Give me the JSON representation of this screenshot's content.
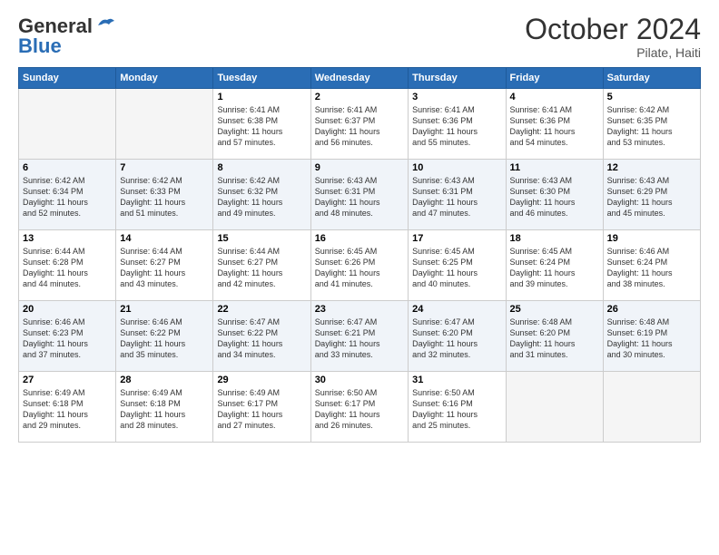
{
  "logo": {
    "part1": "General",
    "part2": "Blue"
  },
  "title": "October 2024",
  "location": "Pilate, Haiti",
  "headers": [
    "Sunday",
    "Monday",
    "Tuesday",
    "Wednesday",
    "Thursday",
    "Friday",
    "Saturday"
  ],
  "weeks": [
    [
      {
        "day": "",
        "info": ""
      },
      {
        "day": "",
        "info": ""
      },
      {
        "day": "1",
        "info": "Sunrise: 6:41 AM\nSunset: 6:38 PM\nDaylight: 11 hours\nand 57 minutes."
      },
      {
        "day": "2",
        "info": "Sunrise: 6:41 AM\nSunset: 6:37 PM\nDaylight: 11 hours\nand 56 minutes."
      },
      {
        "day": "3",
        "info": "Sunrise: 6:41 AM\nSunset: 6:36 PM\nDaylight: 11 hours\nand 55 minutes."
      },
      {
        "day": "4",
        "info": "Sunrise: 6:41 AM\nSunset: 6:36 PM\nDaylight: 11 hours\nand 54 minutes."
      },
      {
        "day": "5",
        "info": "Sunrise: 6:42 AM\nSunset: 6:35 PM\nDaylight: 11 hours\nand 53 minutes."
      }
    ],
    [
      {
        "day": "6",
        "info": "Sunrise: 6:42 AM\nSunset: 6:34 PM\nDaylight: 11 hours\nand 52 minutes."
      },
      {
        "day": "7",
        "info": "Sunrise: 6:42 AM\nSunset: 6:33 PM\nDaylight: 11 hours\nand 51 minutes."
      },
      {
        "day": "8",
        "info": "Sunrise: 6:42 AM\nSunset: 6:32 PM\nDaylight: 11 hours\nand 49 minutes."
      },
      {
        "day": "9",
        "info": "Sunrise: 6:43 AM\nSunset: 6:31 PM\nDaylight: 11 hours\nand 48 minutes."
      },
      {
        "day": "10",
        "info": "Sunrise: 6:43 AM\nSunset: 6:31 PM\nDaylight: 11 hours\nand 47 minutes."
      },
      {
        "day": "11",
        "info": "Sunrise: 6:43 AM\nSunset: 6:30 PM\nDaylight: 11 hours\nand 46 minutes."
      },
      {
        "day": "12",
        "info": "Sunrise: 6:43 AM\nSunset: 6:29 PM\nDaylight: 11 hours\nand 45 minutes."
      }
    ],
    [
      {
        "day": "13",
        "info": "Sunrise: 6:44 AM\nSunset: 6:28 PM\nDaylight: 11 hours\nand 44 minutes."
      },
      {
        "day": "14",
        "info": "Sunrise: 6:44 AM\nSunset: 6:27 PM\nDaylight: 11 hours\nand 43 minutes."
      },
      {
        "day": "15",
        "info": "Sunrise: 6:44 AM\nSunset: 6:27 PM\nDaylight: 11 hours\nand 42 minutes."
      },
      {
        "day": "16",
        "info": "Sunrise: 6:45 AM\nSunset: 6:26 PM\nDaylight: 11 hours\nand 41 minutes."
      },
      {
        "day": "17",
        "info": "Sunrise: 6:45 AM\nSunset: 6:25 PM\nDaylight: 11 hours\nand 40 minutes."
      },
      {
        "day": "18",
        "info": "Sunrise: 6:45 AM\nSunset: 6:24 PM\nDaylight: 11 hours\nand 39 minutes."
      },
      {
        "day": "19",
        "info": "Sunrise: 6:46 AM\nSunset: 6:24 PM\nDaylight: 11 hours\nand 38 minutes."
      }
    ],
    [
      {
        "day": "20",
        "info": "Sunrise: 6:46 AM\nSunset: 6:23 PM\nDaylight: 11 hours\nand 37 minutes."
      },
      {
        "day": "21",
        "info": "Sunrise: 6:46 AM\nSunset: 6:22 PM\nDaylight: 11 hours\nand 35 minutes."
      },
      {
        "day": "22",
        "info": "Sunrise: 6:47 AM\nSunset: 6:22 PM\nDaylight: 11 hours\nand 34 minutes."
      },
      {
        "day": "23",
        "info": "Sunrise: 6:47 AM\nSunset: 6:21 PM\nDaylight: 11 hours\nand 33 minutes."
      },
      {
        "day": "24",
        "info": "Sunrise: 6:47 AM\nSunset: 6:20 PM\nDaylight: 11 hours\nand 32 minutes."
      },
      {
        "day": "25",
        "info": "Sunrise: 6:48 AM\nSunset: 6:20 PM\nDaylight: 11 hours\nand 31 minutes."
      },
      {
        "day": "26",
        "info": "Sunrise: 6:48 AM\nSunset: 6:19 PM\nDaylight: 11 hours\nand 30 minutes."
      }
    ],
    [
      {
        "day": "27",
        "info": "Sunrise: 6:49 AM\nSunset: 6:18 PM\nDaylight: 11 hours\nand 29 minutes."
      },
      {
        "day": "28",
        "info": "Sunrise: 6:49 AM\nSunset: 6:18 PM\nDaylight: 11 hours\nand 28 minutes."
      },
      {
        "day": "29",
        "info": "Sunrise: 6:49 AM\nSunset: 6:17 PM\nDaylight: 11 hours\nand 27 minutes."
      },
      {
        "day": "30",
        "info": "Sunrise: 6:50 AM\nSunset: 6:17 PM\nDaylight: 11 hours\nand 26 minutes."
      },
      {
        "day": "31",
        "info": "Sunrise: 6:50 AM\nSunset: 6:16 PM\nDaylight: 11 hours\nand 25 minutes."
      },
      {
        "day": "",
        "info": ""
      },
      {
        "day": "",
        "info": ""
      }
    ]
  ],
  "row_shades": [
    "white",
    "shade",
    "white",
    "shade",
    "white"
  ]
}
